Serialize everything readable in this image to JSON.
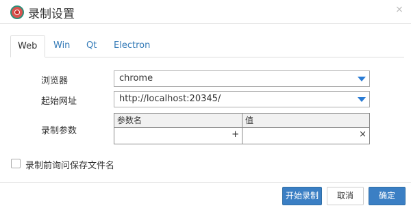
{
  "dialog": {
    "title": "录制设置",
    "close_glyph": "×",
    "icon": "record-icon"
  },
  "tabs": [
    {
      "label": "Web",
      "active": true
    },
    {
      "label": "Win",
      "active": false
    },
    {
      "label": "Qt",
      "active": false
    },
    {
      "label": "Electron",
      "active": false
    }
  ],
  "form": {
    "browser_label": "浏览器",
    "browser_value": "chrome",
    "start_url_label": "起始网址",
    "start_url_value": "http://localhost:20345/",
    "params_label": "录制参数",
    "params_table": {
      "headers": [
        "参数名",
        "值"
      ],
      "add_glyph": "+",
      "remove_glyph": "×"
    },
    "save_filename_label": "录制前询问保存文件名",
    "save_filename_checked": false
  },
  "footer": {
    "start_label": "开始录制",
    "cancel_label": "取消",
    "ok_label": "确定"
  },
  "colors": {
    "primary": "#3b7fc4",
    "link": "#337ab7",
    "arrow": "#2a7bd4"
  }
}
